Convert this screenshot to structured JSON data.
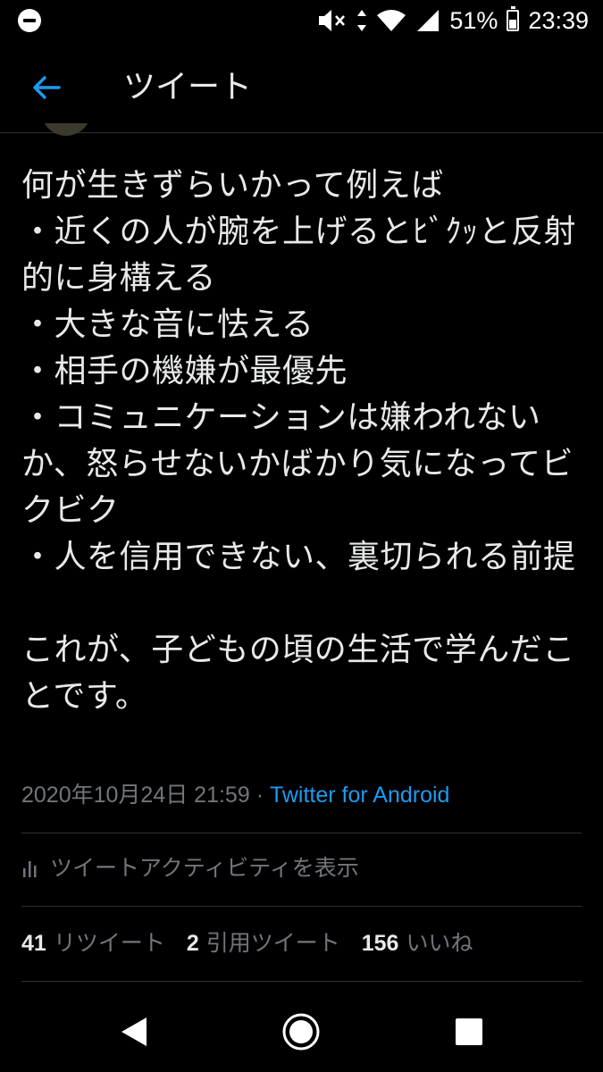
{
  "status_bar": {
    "battery": "51%",
    "time": "23:39",
    "battery_level": 0.51,
    "icons": [
      "do-not-disturb-icon",
      "mute-icon",
      "data-arrows-icon",
      "wifi-icon",
      "signal-icon",
      "battery-icon"
    ]
  },
  "header": {
    "title": "ツイート",
    "back_icon": "arrow-left-icon",
    "accent": "#1d9bf0"
  },
  "tweet": {
    "text": "何が生きずらいかって例えば\n・近くの人が腕を上げるとﾋﾞｸｯと反射的に身構える\n・大きな音に怯える\n・相手の機嫌が最優先\n・コミュニケーションは嫌われないか、怒らせないかばかり気になってビクビク\n・人を信用できない、裏切られる前提\n\nこれが、子どもの頃の生活で学んだことです。",
    "timestamp": "2020年10月24日 21:59",
    "separator": " · ",
    "source": "Twitter for Android"
  },
  "activity": {
    "label": "ツイートアクティビティを表示",
    "icon": "bar-chart-icon"
  },
  "stats": {
    "retweets": {
      "count": "41",
      "label": "リツイート"
    },
    "quotes": {
      "count": "2",
      "label": "引用ツイート"
    },
    "likes": {
      "count": "156",
      "label": "いいね"
    }
  },
  "nav_bar": {
    "icons": [
      "nav-back-icon",
      "nav-home-icon",
      "nav-recents-icon"
    ]
  }
}
